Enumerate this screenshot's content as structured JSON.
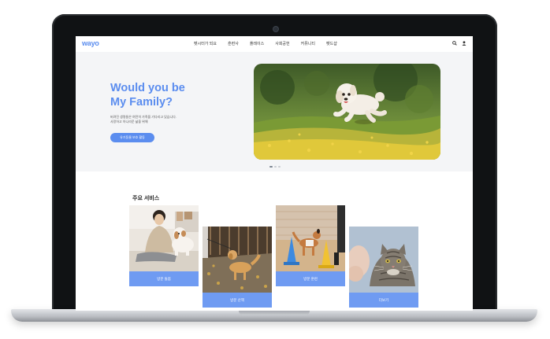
{
  "nav": {
    "logo": "wayo",
    "items": [
      "펫시터가 되요",
      "훈련사",
      "플레이스",
      "사회공헌",
      "커뮤니티",
      "펫드샵"
    ]
  },
  "hero": {
    "title_line1": "Would you be",
    "title_line2": "My Family?",
    "desc_line1": "버려진 생명들은 여전히 가족을 기다리고 있습니다.",
    "desc_line2": "사랑하고 아니라운 삶을 위해",
    "button_label": "유기동물 보호 활동"
  },
  "services": {
    "title": "주요 서비스",
    "cards": [
      {
        "label": "방문 돌봄"
      },
      {
        "label": "방문 산책"
      },
      {
        "label": "방문 훈련"
      },
      {
        "label": "더보기"
      }
    ]
  },
  "colors": {
    "accent": "#5b8def",
    "card_label": "#6f9bf2",
    "hero_bg": "#f4f5f7"
  }
}
